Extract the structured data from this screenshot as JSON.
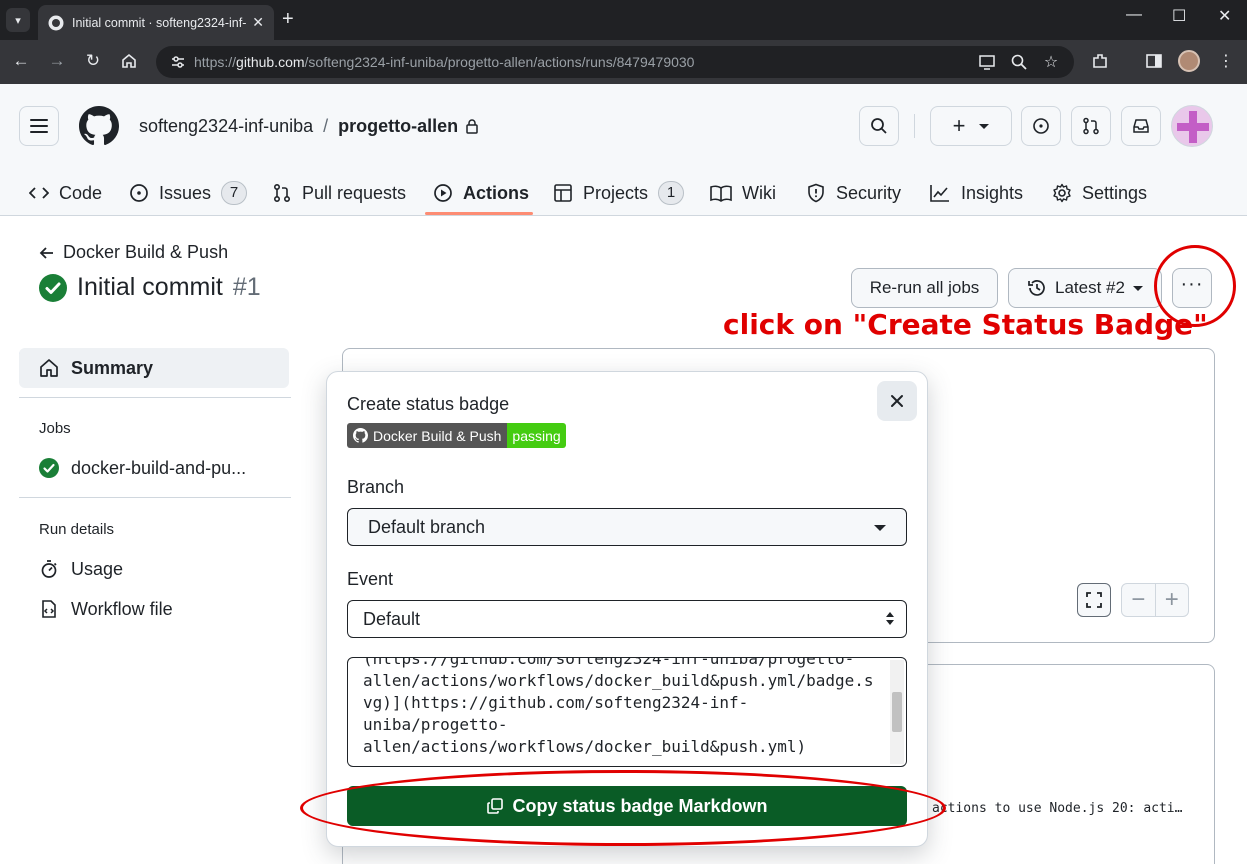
{
  "browser": {
    "tab_title": "Initial commit · softeng2324-inf-",
    "url_prefix": "https://",
    "url_host": "github.com",
    "url_path": "/softeng2324-inf-uniba/progetto-allen/actions/runs/8479479030"
  },
  "repo": {
    "owner": "softeng2324-inf-uniba",
    "separator": "/",
    "name": "progetto-allen"
  },
  "nav": {
    "code": "Code",
    "issues": "Issues",
    "issues_count": "7",
    "pulls": "Pull requests",
    "actions": "Actions",
    "projects": "Projects",
    "projects_count": "1",
    "wiki": "Wiki",
    "security": "Security",
    "insights": "Insights",
    "settings": "Settings"
  },
  "run": {
    "back_label": "Docker Build & Push",
    "title": "Initial commit",
    "number": "#1",
    "rerun_label": "Re-run all jobs",
    "latest_label": "Latest #2"
  },
  "annotation": "click on \"Create Status Badge\"",
  "sidebar": {
    "summary": "Summary",
    "jobs_heading": "Jobs",
    "job": "docker-build-and-pu...",
    "run_details_heading": "Run details",
    "usage": "Usage",
    "workflow_file": "Workflow file"
  },
  "log_text": "actions to use Node.js 20: acti…",
  "modal": {
    "title": "Create status badge",
    "badge_left": "Docker Build & Push",
    "badge_right": "passing",
    "branch_label": "Branch",
    "branch_value": "Default branch",
    "event_label": "Event",
    "event_value": "Default",
    "markdown_lines": [
      "(https://github.com/softeng2324-inf-uniba/progetto-",
      "allen/actions/workflows/docker_build&push.yml/badge.s",
      "vg)](https://github.com/softeng2324-inf-",
      "uniba/progetto-",
      "allen/actions/workflows/docker_build&push.yml)"
    ],
    "copy_button": "Copy status badge Markdown"
  },
  "colors": {
    "accent_green": "#0a5c26",
    "success": "#1a7f37",
    "annotation_red": "#e00000",
    "nav_underline": "#fd8c73"
  }
}
